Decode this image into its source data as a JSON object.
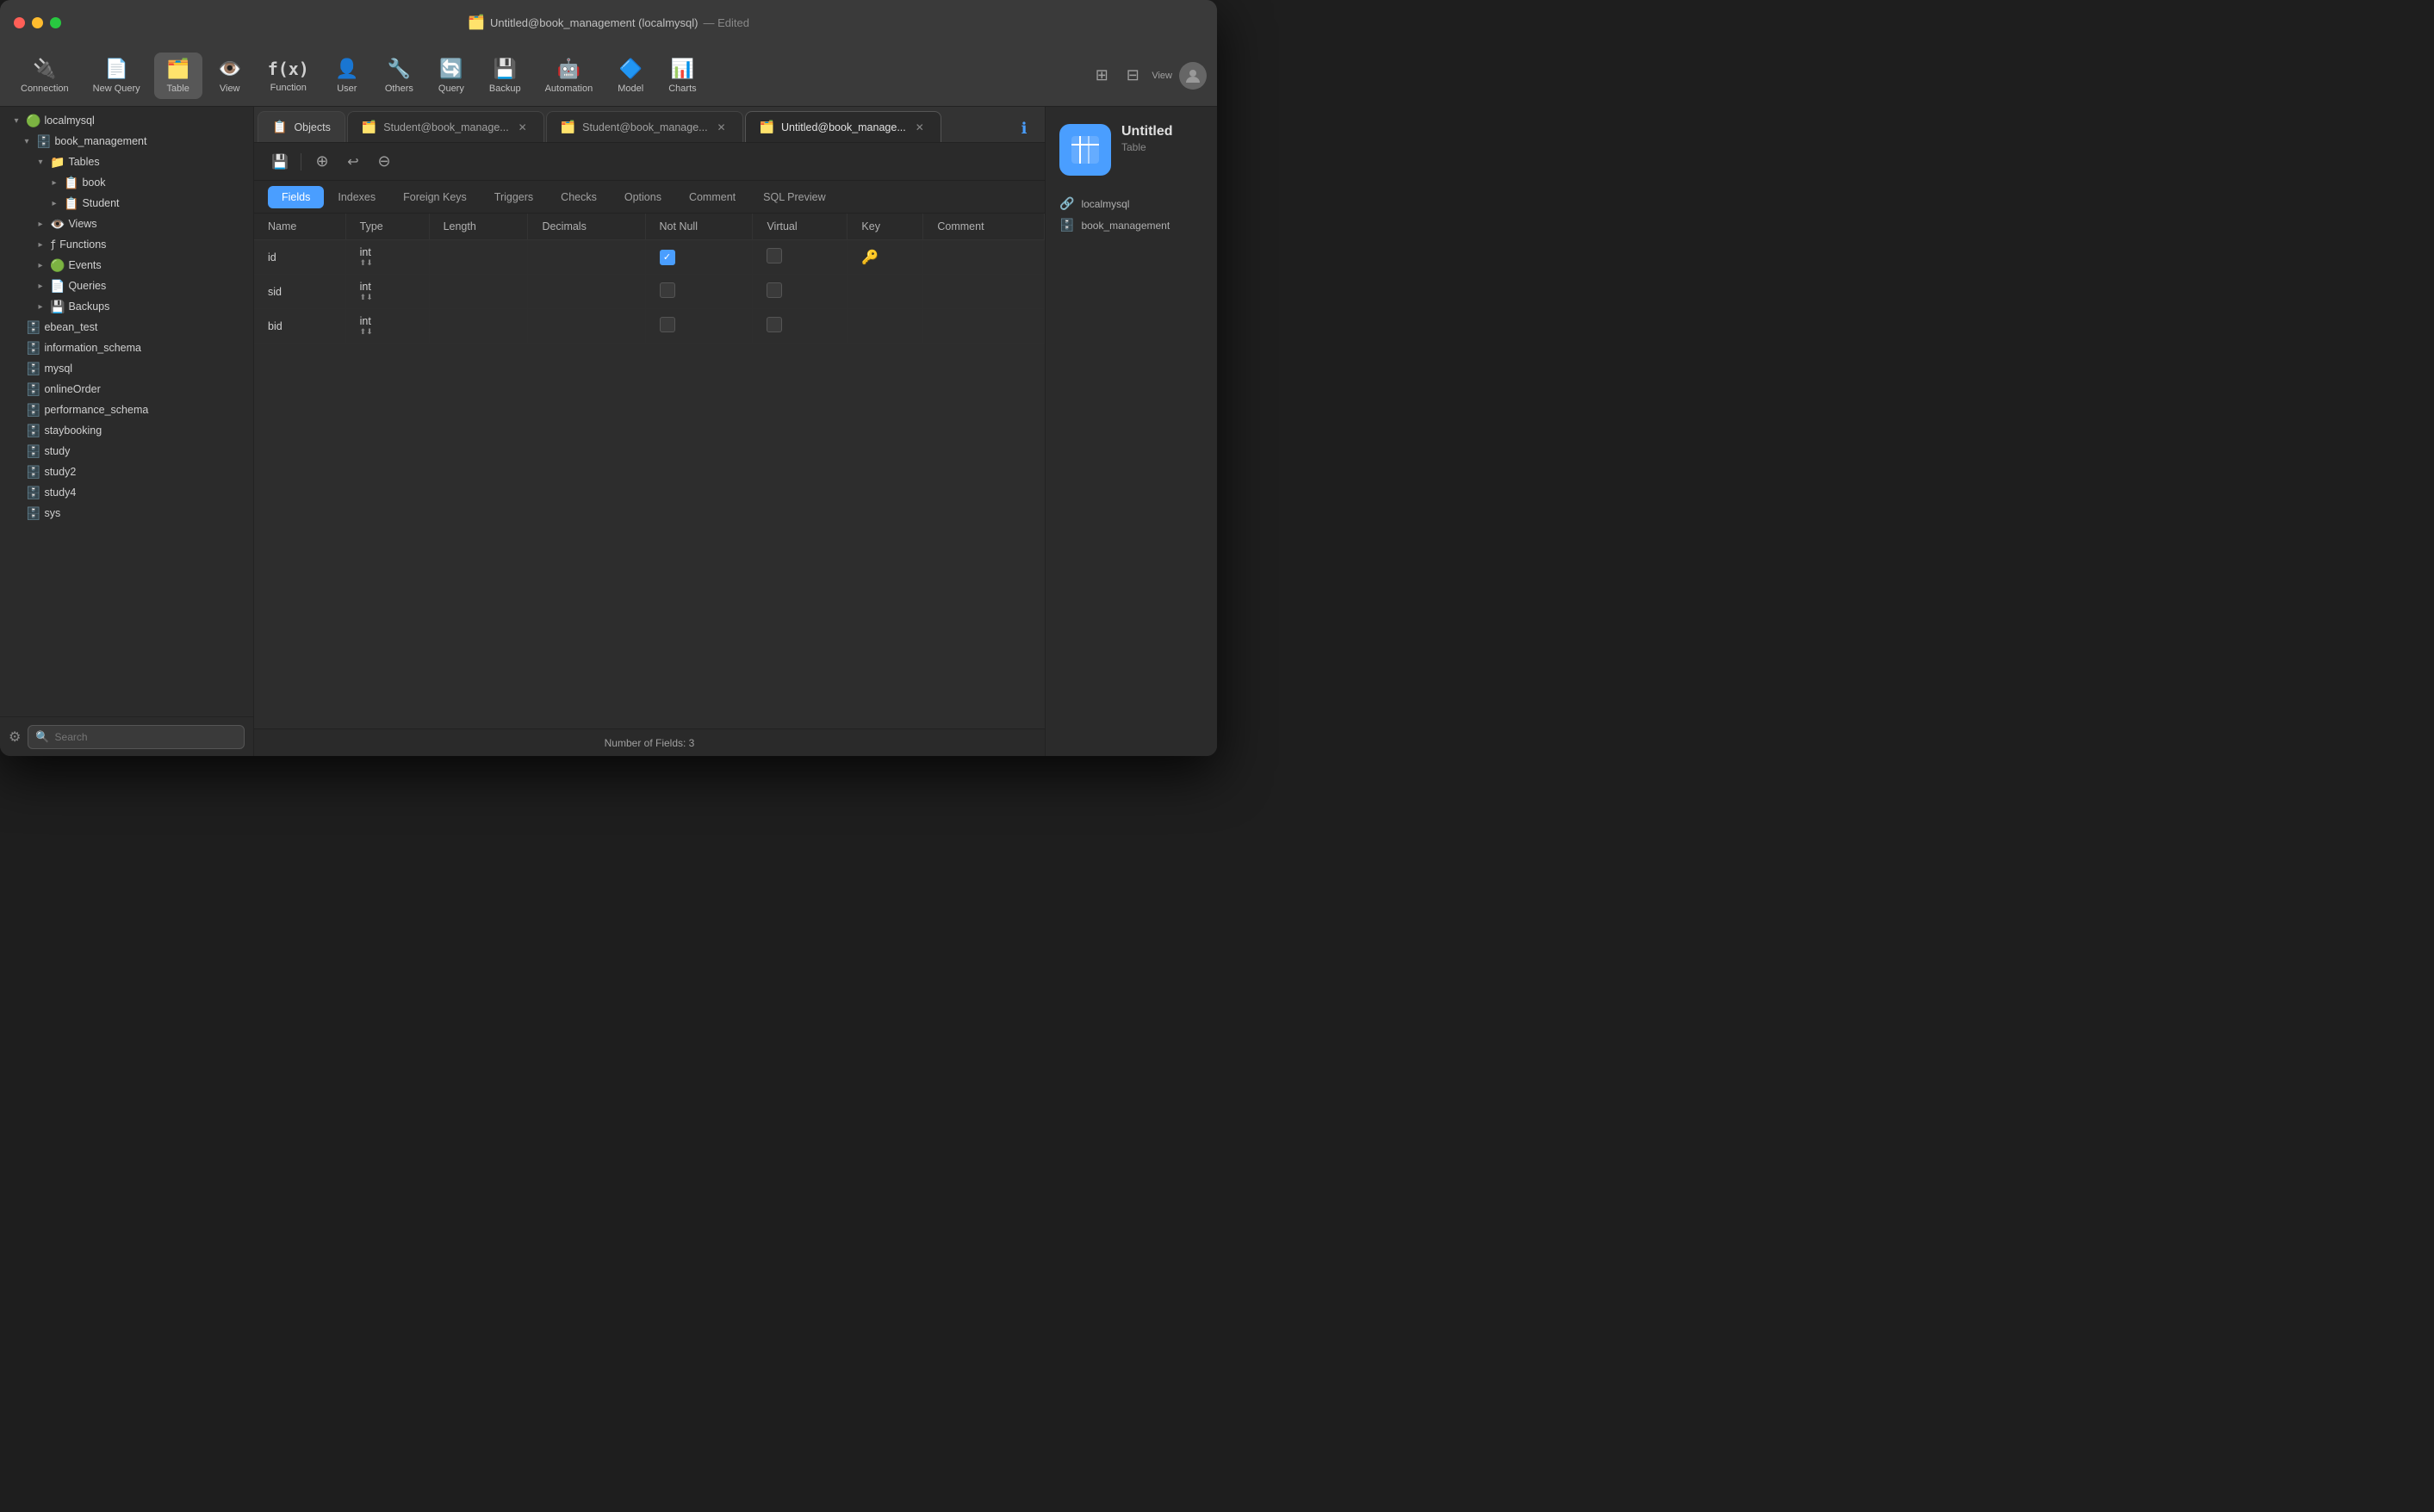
{
  "window": {
    "title": "Untitled@book_management (localmysql)",
    "subtitle": "— Edited"
  },
  "toolbar": {
    "items": [
      {
        "id": "connection",
        "label": "Connection",
        "icon": "🔌"
      },
      {
        "id": "new-query",
        "label": "New Query",
        "icon": "📄"
      },
      {
        "id": "table",
        "label": "Table",
        "icon": "🗂️"
      },
      {
        "id": "view",
        "label": "View",
        "icon": "👁️"
      },
      {
        "id": "function",
        "label": "Function",
        "icon": "ƒ"
      },
      {
        "id": "user",
        "label": "User",
        "icon": "👤"
      },
      {
        "id": "others",
        "label": "Others",
        "icon": "🔧"
      },
      {
        "id": "query",
        "label": "Query",
        "icon": "🔄"
      },
      {
        "id": "backup",
        "label": "Backup",
        "icon": "💾"
      },
      {
        "id": "automation",
        "label": "Automation",
        "icon": "🤖"
      },
      {
        "id": "model",
        "label": "Model",
        "icon": "🔷"
      },
      {
        "id": "charts",
        "label": "Charts",
        "icon": "📊"
      }
    ],
    "view_label": "View"
  },
  "tabs": [
    {
      "id": "objects",
      "label": "Objects",
      "icon": "📋",
      "active": false
    },
    {
      "id": "student1",
      "label": "Student@book_manage...",
      "icon": "🗂️",
      "active": false
    },
    {
      "id": "student2",
      "label": "Student@book_manage...",
      "icon": "🗂️",
      "active": false
    },
    {
      "id": "untitled",
      "label": "Untitled@book_manage...",
      "icon": "🗂️",
      "active": true
    }
  ],
  "table_toolbar": {
    "save_icon": "💾",
    "add_icon": "＋",
    "undo_icon": "↩",
    "delete_icon": "－"
  },
  "sub_tabs": [
    {
      "id": "fields",
      "label": "Fields",
      "active": true
    },
    {
      "id": "indexes",
      "label": "Indexes",
      "active": false
    },
    {
      "id": "foreign-keys",
      "label": "Foreign Keys",
      "active": false
    },
    {
      "id": "triggers",
      "label": "Triggers",
      "active": false
    },
    {
      "id": "checks",
      "label": "Checks",
      "active": false
    },
    {
      "id": "options",
      "label": "Options",
      "active": false
    },
    {
      "id": "comment",
      "label": "Comment",
      "active": false
    },
    {
      "id": "sql-preview",
      "label": "SQL Preview",
      "active": false
    }
  ],
  "table_columns": [
    "Name",
    "Type",
    "Length",
    "Decimals",
    "Not Null",
    "Virtual",
    "Key",
    "Comment"
  ],
  "table_rows": [
    {
      "name": "id",
      "type": "int",
      "length": "",
      "decimals": "",
      "not_null": true,
      "virtual": false,
      "key": "primary",
      "comment": ""
    },
    {
      "name": "sid",
      "type": "int",
      "length": "",
      "decimals": "",
      "not_null": false,
      "virtual": false,
      "key": "none",
      "comment": ""
    },
    {
      "name": "bid",
      "type": "int",
      "length": "",
      "decimals": "",
      "not_null": false,
      "virtual": false,
      "key": "none",
      "comment": ""
    }
  ],
  "status_bar": {
    "text": "Number of Fields: 3"
  },
  "sidebar": {
    "server": "localmysql",
    "databases": [
      {
        "name": "book_management",
        "expanded": true,
        "children": [
          {
            "name": "Tables",
            "expanded": true,
            "children": [
              {
                "name": "book",
                "expanded": false
              },
              {
                "name": "Student",
                "expanded": false
              }
            ]
          },
          {
            "name": "Views",
            "expanded": false
          },
          {
            "name": "Functions",
            "expanded": false
          },
          {
            "name": "Events",
            "expanded": false
          },
          {
            "name": "Queries",
            "expanded": false
          },
          {
            "name": "Backups",
            "expanded": false
          }
        ]
      },
      {
        "name": "ebean_test",
        "expanded": false
      },
      {
        "name": "information_schema",
        "expanded": false
      },
      {
        "name": "mysql",
        "expanded": false
      },
      {
        "name": "onlineOrder",
        "expanded": false
      },
      {
        "name": "performance_schema",
        "expanded": false
      },
      {
        "name": "staybooking",
        "expanded": false
      },
      {
        "name": "study",
        "expanded": false
      },
      {
        "name": "study2",
        "expanded": false
      },
      {
        "name": "study4",
        "expanded": false
      },
      {
        "name": "sys",
        "expanded": false
      }
    ],
    "search_placeholder": "Search"
  },
  "right_panel": {
    "title": "Untitled",
    "subtitle": "Table",
    "server": "localmysql",
    "database": "book_management"
  }
}
